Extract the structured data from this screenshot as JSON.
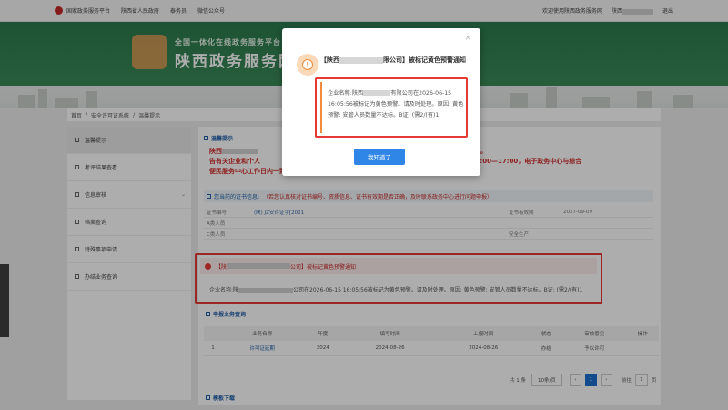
{
  "topbar": {
    "links": [
      "国家政务服务平台",
      "陕西省人民政府",
      "泰务员",
      "微信公众号"
    ],
    "welcome": "欢迎使用陕西政务服务网",
    "user_prefix": "陕西",
    "logout": "退出"
  },
  "banner": {
    "subtitle": "全国一体化在线政务服务平台",
    "title": "陕西政务服务网"
  },
  "breadcrumb": [
    "首页",
    "/",
    "安全许可证系统",
    "/",
    "温馨提示"
  ],
  "sidebar": {
    "items": [
      {
        "label": "温馨提示"
      },
      {
        "label": "考评结果查看"
      },
      {
        "label": "信息审核"
      },
      {
        "label": "档案查询"
      },
      {
        "label": "特殊事项申请"
      },
      {
        "label": "办结业务查询"
      }
    ]
  },
  "main": {
    "tip_heading": "温馨提示",
    "tip_line1_prefix": "陕西",
    "tip_line1_suffix": "信息。",
    "tip_line2": "告有关企业和个人",
    "tip_line2_right": "上午9:00—12:00，下午13:00—17:00，电子政务中心与综合",
    "tip_line3": "便民服务中心工作日内一致！",
    "warn_band_label": "您当前的证书信息:",
    "warn_band_note": "（若您认真核对证书编号、资质信息、证书有效期是否正确，及时联系政务中心进行问题申报）",
    "info_rows": [
      {
        "k": "证书编号",
        "v": "(陕) JZ安许证字[2021",
        "k2": "证书有效期",
        "v2": "2027-09-09"
      },
      {
        "k": "A类人员",
        "v": "",
        "k2": "",
        "v2": ""
      },
      {
        "k": "C类人员",
        "v": "",
        "k2": "安全生产",
        "v2": ""
      }
    ]
  },
  "notice": {
    "head_prefix": "【陕",
    "head_suffix": "公司】被标记黄色预警通知",
    "body_prefix": "企业名称:陕",
    "body_suffix": "公司在2026-06-15 16:05:56被标记为黄色预警。请及时处理。原因: 黄色预警: 安管人员数量不达标。B证: (需2/(有)1"
  },
  "apply": {
    "heading": "申报业务查询",
    "columns": [
      "",
      "业务名称",
      "年度",
      "填写时间",
      "上报时间",
      "状态",
      "审核意见",
      "操作"
    ],
    "rows": [
      [
        "1",
        "许可证延期",
        "2024",
        "2024-08-26",
        "2024-08-26",
        "办结",
        "予以许可",
        ""
      ]
    ]
  },
  "pager": {
    "total": "共 1 条",
    "page_size": "10条/页",
    "prev": "‹",
    "current": "1",
    "next": "›",
    "goto_label": "前往",
    "goto_value": "1",
    "page_suffix": "页"
  },
  "download": {
    "heading": "模板下载"
  },
  "modal": {
    "close": "×",
    "title_prefix": "【陕西",
    "title_suffix": "限公司】被标记黄色预警通知",
    "body_prefix": "企业名称:陕西",
    "body_mid": "有限公司在2026-06-15 16:05:56被标记为黄色预警。请及时处理。原因: 黄色预警: 安管人员数量不达标。B证: (需2/(有)1",
    "confirm": "我知道了"
  }
}
